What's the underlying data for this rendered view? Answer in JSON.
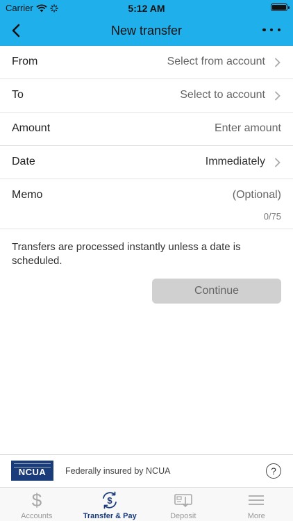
{
  "status_bar": {
    "carrier": "Carrier",
    "time": "5:12 AM"
  },
  "header": {
    "title": "New transfer"
  },
  "form": {
    "from": {
      "label": "From",
      "value": "Select from account"
    },
    "to": {
      "label": "To",
      "value": "Select to account"
    },
    "amount": {
      "label": "Amount",
      "placeholder": "Enter amount"
    },
    "date": {
      "label": "Date",
      "value": "Immediately"
    },
    "memo": {
      "label": "Memo",
      "placeholder": "(Optional)",
      "counter": "0/75"
    }
  },
  "note": "Transfers are processed instantly unless a date is scheduled.",
  "continue_label": "Continue",
  "footer": {
    "logo_text": "NCUA",
    "insured_text": "Federally insured by NCUA",
    "help_label": "?"
  },
  "tabs": [
    {
      "label": "Accounts",
      "icon": "dollar-icon",
      "active": false
    },
    {
      "label": "Transfer & Pay",
      "icon": "transfer-dollar-icon",
      "active": true
    },
    {
      "label": "Deposit",
      "icon": "check-deposit-icon",
      "active": false
    },
    {
      "label": "More",
      "icon": "menu-icon",
      "active": false
    }
  ],
  "colors": {
    "header": "#1fb0ec",
    "active_tab": "#1a3c7a",
    "button_disabled": "#d0d0d0"
  }
}
